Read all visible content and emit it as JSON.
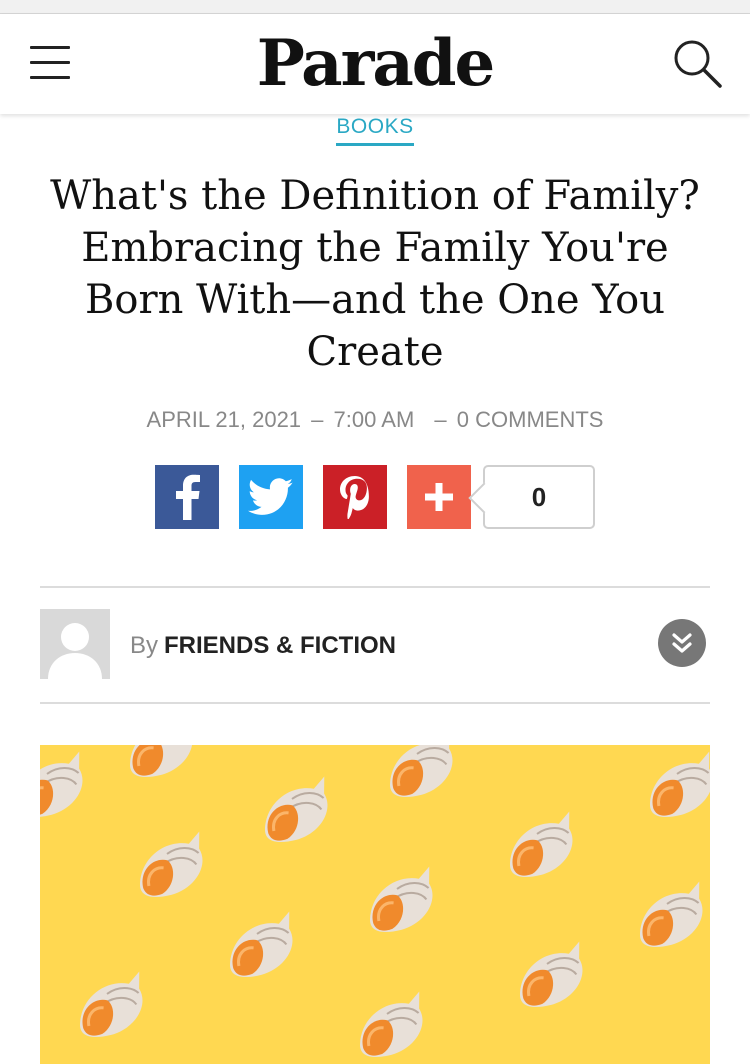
{
  "header": {
    "logo_text": "Parade",
    "menu_icon": "hamburger-menu-icon",
    "search_icon": "search-icon"
  },
  "article": {
    "category": "BOOKS",
    "title": "What's the Definition of Family? Embracing the Family You're Born With—and the One You Create",
    "date": "APRIL 21, 2021",
    "dash1": "–",
    "time": "7:00 AM",
    "dash2": "–",
    "comments": "0 COMMENTS"
  },
  "share": {
    "buttons": [
      {
        "network": "facebook",
        "icon": "facebook-icon",
        "color": "#3b5998"
      },
      {
        "network": "twitter",
        "icon": "twitter-icon",
        "color": "#1ea1f2"
      },
      {
        "network": "pinterest",
        "icon": "pinterest-icon",
        "color": "#cb2027"
      },
      {
        "network": "more",
        "icon": "plus-icon",
        "color": "#f0624c"
      }
    ],
    "count": "0"
  },
  "author": {
    "by_label": "By",
    "name": "FRIENDS & FICTION",
    "avatar_icon": "default-avatar-icon",
    "expand_icon": "chevron-double-down-icon"
  },
  "hero_image": {
    "background_color": "#ffd851",
    "subject": "seashells pattern"
  },
  "colors": {
    "accent": "#2aa8c4",
    "meta_text": "#888888"
  }
}
